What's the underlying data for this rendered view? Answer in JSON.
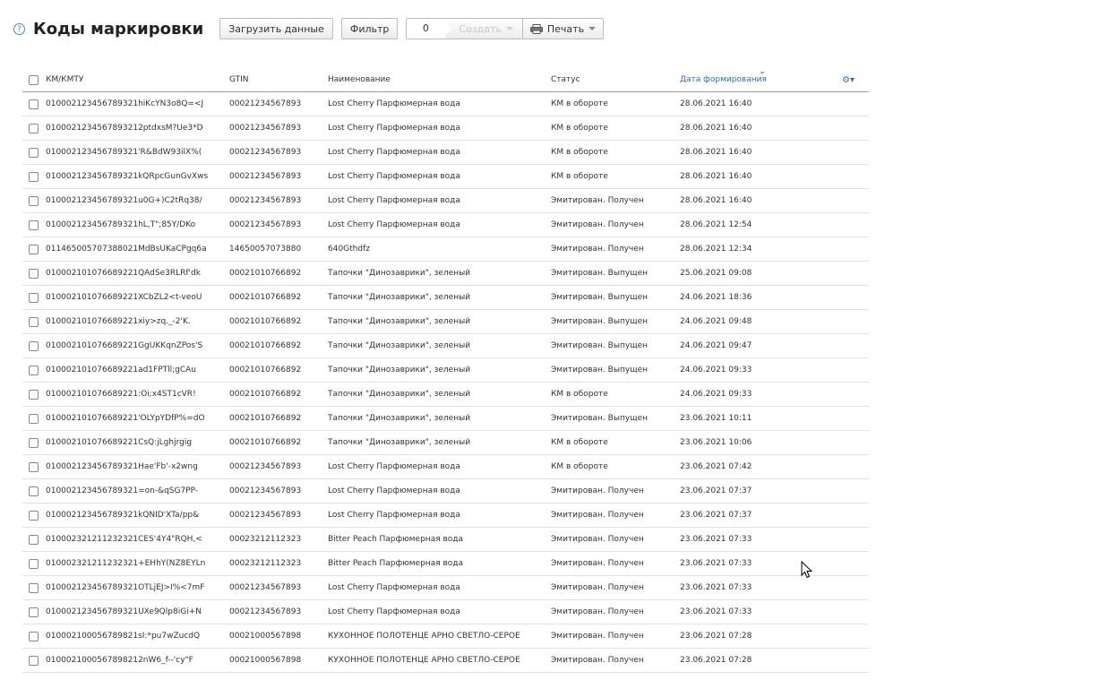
{
  "header": {
    "help": "?",
    "title": "Коды маркировки",
    "load_label": "Загрузить данные",
    "filter_label": "Фильтр",
    "counter": "0",
    "create_label": "Создать",
    "print_label": "Печать"
  },
  "table": {
    "columns": {
      "km": "КМ/КМТУ",
      "gtin": "GTIN",
      "name": "Наименование",
      "status": "Статус",
      "date": "Дата формирования"
    },
    "rows": [
      {
        "km": "010002123456789321hiKcYN3o8Q=<J",
        "gtin": "00021234567893",
        "name": "Lost Cherry Парфюмерная вода",
        "status": "КМ в обороте",
        "date": "28.06.2021 16:40"
      },
      {
        "km": "0100021234567893212ptdxsM?Ue3*D",
        "gtin": "00021234567893",
        "name": "Lost Cherry Парфюмерная вода",
        "status": "КМ в обороте",
        "date": "28.06.2021 16:40"
      },
      {
        "km": "010002123456789321'R&BdW93ilX%(",
        "gtin": "00021234567893",
        "name": "Lost Cherry Парфюмерная вода",
        "status": "КМ в обороте",
        "date": "28.06.2021 16:40"
      },
      {
        "km": "010002123456789321kQRpcGunGvXws",
        "gtin": "00021234567893",
        "name": "Lost Cherry Парфюмерная вода",
        "status": "КМ в обороте",
        "date": "28.06.2021 16:40"
      },
      {
        "km": "010002123456789321u0G+)C2tRq38/",
        "gtin": "00021234567893",
        "name": "Lost Cherry Парфюмерная вода",
        "status": "Эмитирован. Получен",
        "date": "28.06.2021 16:40"
      },
      {
        "km": "010002123456789321hL,T\";85Y/DKo",
        "gtin": "00021234567893",
        "name": "Lost Cherry Парфюмерная вода",
        "status": "Эмитирован. Получен",
        "date": "28.06.2021 12:54"
      },
      {
        "km": "011465005707388021MdBsUKaCPgq6a",
        "gtin": "14650057073880",
        "name": "640Gthdfz",
        "status": "Эмитирован. Получен",
        "date": "28.06.2021 12:34"
      },
      {
        "km": "010002101076689221QAdSe3RLRf'dk",
        "gtin": "00021010766892",
        "name": "Тапочки \"Динозаврики\", зеленый",
        "status": "Эмитирован. Выпущен",
        "date": "25.06.2021 09:08"
      },
      {
        "km": "010002101076689221XCbZL2<t-veoU",
        "gtin": "00021010766892",
        "name": "Тапочки \"Динозаврики\", зеленый",
        "status": "Эмитирован. Выпущен",
        "date": "24.06.2021 18:36"
      },
      {
        "km": "010002101076689221xiy>zq._-2'K.",
        "gtin": "00021010766892",
        "name": "Тапочки \"Динозаврики\", зеленый",
        "status": "Эмитирован. Выпущен",
        "date": "24.06.2021 09:48"
      },
      {
        "km": "010002101076689221GgUKKqnZPos'S",
        "gtin": "00021010766892",
        "name": "Тапочки \"Динозаврики\", зеленый",
        "status": "Эмитирован. Выпущен",
        "date": "24.06.2021 09:47"
      },
      {
        "km": "010002101076689221ad1FPTll;gCAu",
        "gtin": "00021010766892",
        "name": "Тапочки \"Динозаврики\", зеленый",
        "status": "Эмитирован. Выпущен",
        "date": "24.06.2021 09:33"
      },
      {
        "km": "010002101076689221:Oi;x4ST1cVR!",
        "gtin": "00021010766892",
        "name": "Тапочки \"Динозаврики\", зеленый",
        "status": "КМ в обороте",
        "date": "24.06.2021 09:33"
      },
      {
        "km": "010002101076689221'OLYpYDfP%=dO",
        "gtin": "00021010766892",
        "name": "Тапочки \"Динозаврики\", зеленый",
        "status": "Эмитирован. Выпущен",
        "date": "23.06.2021 10:11"
      },
      {
        "km": "010002101076689221CsQ:jLghjrgig",
        "gtin": "00021010766892",
        "name": "Тапочки \"Динозаврики\", зеленый",
        "status": "КМ в обороте",
        "date": "23.06.2021 10:06"
      },
      {
        "km": "010002123456789321Hae'Fb'-x2wng",
        "gtin": "00021234567893",
        "name": "Lost Cherry Парфюмерная вода",
        "status": "КМ в обороте",
        "date": "23.06.2021 07:42"
      },
      {
        "km": "010002123456789321=on-&qSG7PP-",
        "gtin": "00021234567893",
        "name": "Lost Cherry Парфюмерная вода",
        "status": "Эмитирован. Получен",
        "date": "23.06.2021 07:37"
      },
      {
        "km": "010002123456789321kQNID'XTa/pp&",
        "gtin": "00021234567893",
        "name": "Lost Cherry Парфюмерная вода",
        "status": "Эмитирован. Получен",
        "date": "23.06.2021 07:37"
      },
      {
        "km": "010002321211232321CES'4Y4\"RQH,<",
        "gtin": "00023212112323",
        "name": "Bitter Peach Парфюмерная вода",
        "status": "Эмитирован. Получен",
        "date": "23.06.2021 07:33"
      },
      {
        "km": "010002321211232321+EHhY(NZ8EYLn",
        "gtin": "00023212112323",
        "name": "Bitter Peach Парфюмерная вода",
        "status": "Эмитирован. Получен",
        "date": "23.06.2021 07:33"
      },
      {
        "km": "010002123456789321OTLjEJ>I%<7mF",
        "gtin": "00021234567893",
        "name": "Lost Cherry Парфюмерная вода",
        "status": "Эмитирован. Получен",
        "date": "23.06.2021 07:33"
      },
      {
        "km": "010002123456789321UXe9Qlp8iGi+N",
        "gtin": "00021234567893",
        "name": "Lost Cherry Парфюмерная вода",
        "status": "Эмитирован. Получен",
        "date": "23.06.2021 07:33"
      },
      {
        "km": "010002100056789821sI:*pu7wZucdQ",
        "gtin": "00021000567898",
        "name": "КУХОННОЕ ПОЛОТЕНЦЕ АРНО СВЕТЛО-СЕРОЕ",
        "status": "Эмитирован. Получен",
        "date": "23.06.2021 07:28"
      },
      {
        "km": "0100021000567898212nW6_f--'cy\"F",
        "gtin": "00021000567898",
        "name": "КУХОННОЕ ПОЛОТЕНЦЕ АРНО СВЕТЛО-СЕРОЕ",
        "status": "Эмитирован. Получен",
        "date": "23.06.2021 07:28"
      }
    ]
  }
}
